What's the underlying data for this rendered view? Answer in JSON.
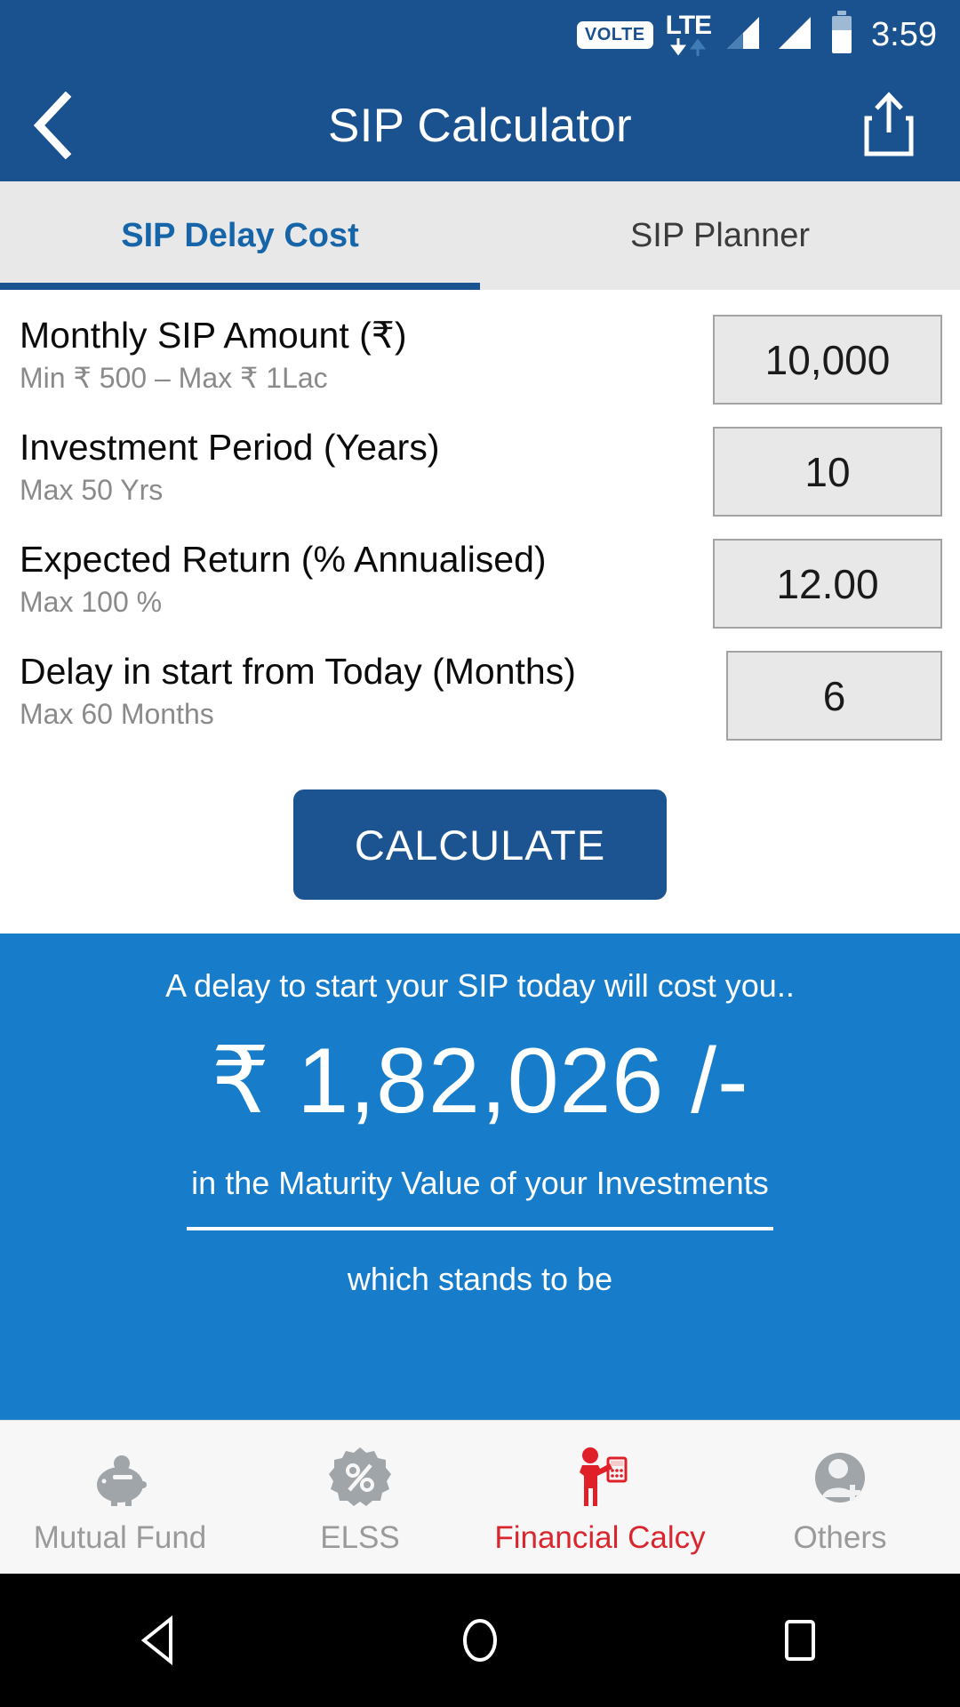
{
  "statusbar": {
    "volte": "VOLTE",
    "network": "LTE",
    "time": "3:59",
    "icons": [
      "volte-badge",
      "lte-icon",
      "signal-bars-1-icon",
      "signal-bars-2-icon",
      "battery-icon"
    ]
  },
  "appbar": {
    "title": "SIP Calculator",
    "back_icon": "back-chevron-icon",
    "share_icon": "share-icon"
  },
  "tabs": [
    {
      "label": "SIP Delay Cost",
      "active": true
    },
    {
      "label": "SIP Planner",
      "active": false
    }
  ],
  "form": {
    "rows": [
      {
        "label": "Monthly SIP Amount (₹)",
        "sublabel": "Min ₹ 500 – Max ₹ 1Lac",
        "value": "10,000"
      },
      {
        "label": "Investment Period (Years)",
        "sublabel": "Max 50 Yrs",
        "value": "10"
      },
      {
        "label": "Expected Return (% Annualised)",
        "sublabel": "Max 100 %",
        "value": "12.00"
      },
      {
        "label": "Delay in start from Today (Months)",
        "sublabel": "Max 60 Months",
        "value": "6"
      }
    ],
    "calculate_label": "CALCULATE"
  },
  "result": {
    "caption": "A delay to start your SIP today will cost you..",
    "amount": "₹ 1,82,026 /-",
    "subtext": "in the Maturity Value of your Investments",
    "footer": "which stands to be"
  },
  "bottomnav": [
    {
      "label": "Mutual Fund",
      "icon": "piggy-bank-icon",
      "active": false
    },
    {
      "label": "ELSS",
      "icon": "percent-badge-icon",
      "active": false
    },
    {
      "label": "Financial Calcy",
      "icon": "person-calculator-icon",
      "active": true
    },
    {
      "label": "Others",
      "icon": "person-add-icon",
      "active": false
    }
  ],
  "androidnav": {
    "back": "android-back-icon",
    "home": "android-home-icon",
    "recents": "android-recents-icon"
  },
  "colors": {
    "appbar_blue": "#1a518f",
    "result_blue": "#177cc9",
    "tab_active_blue": "#1565a8",
    "accent_red": "#d9262e",
    "field_gray": "#e8e8e8"
  }
}
